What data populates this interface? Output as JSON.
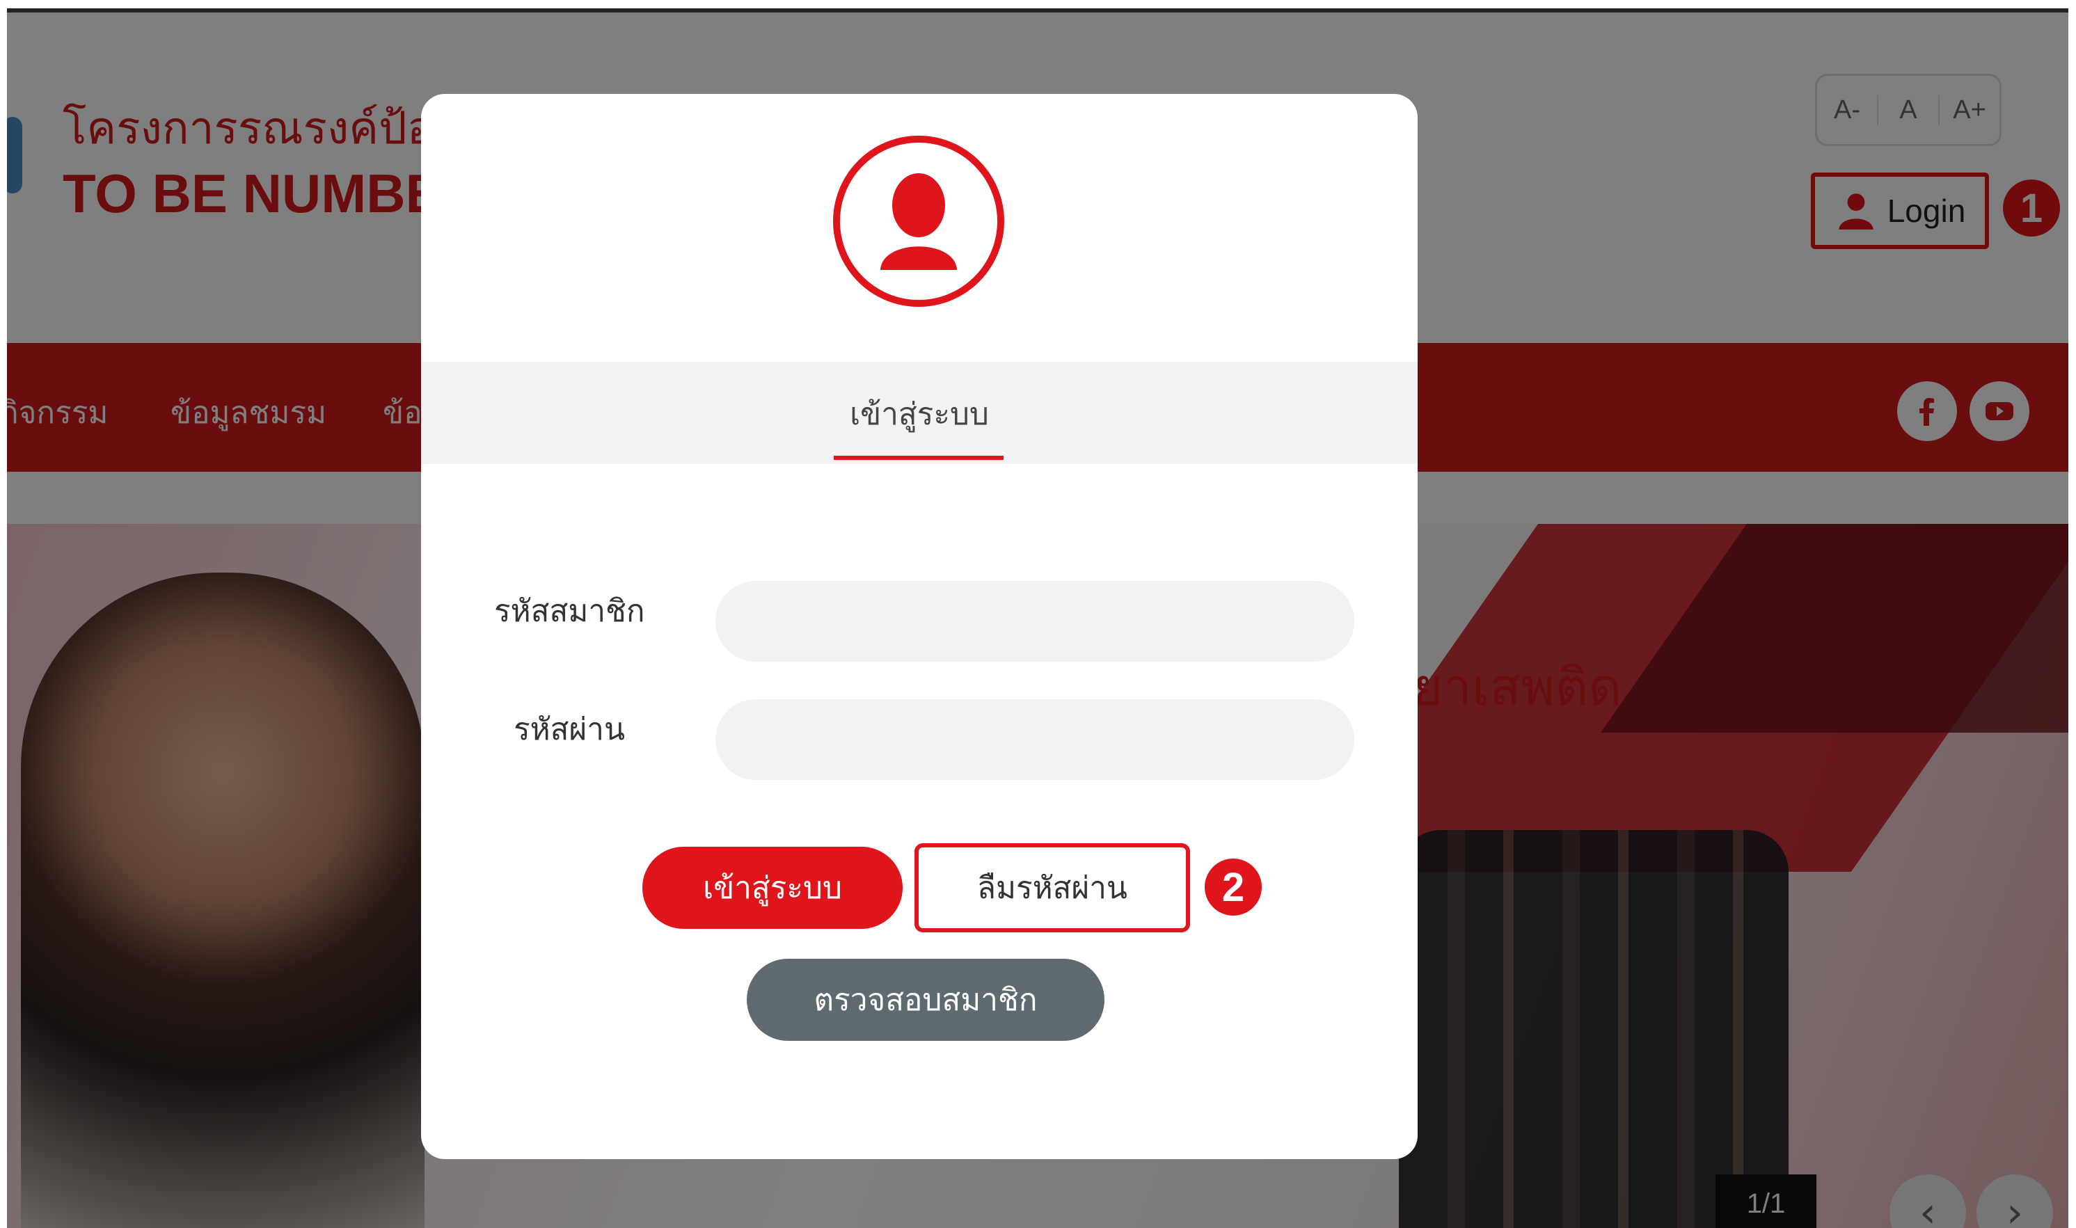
{
  "header": {
    "logo_line1": "โครงการรณรงค์ป้อ",
    "logo_line2": "TO BE NUMBER",
    "font_size_controls": [
      "A-",
      "A",
      "A+"
    ],
    "login_label": "Login",
    "step1_badge": "1"
  },
  "nav": {
    "items": [
      "กิจกรรม",
      "ข้อมูลชมรม",
      "ข้อ"
    ],
    "social": [
      "facebook-icon",
      "youtube-icon"
    ]
  },
  "hero": {
    "title": "ยาเสพติด",
    "pager": "1/1",
    "prev_arrow": "‹",
    "next_arrow": "›"
  },
  "modal": {
    "tab_label": "เข้าสู่ระบบ",
    "member_id_label": "รหัสสมาชิก",
    "member_id_value": "",
    "password_label": "รหัสผ่าน",
    "password_value": "",
    "login_button": "เข้าสู่ระบบ",
    "forgot_button": "ลืมรหัสผ่าน",
    "step2_badge": "2",
    "check_member_button": "ตรวจสอบสมาชิก"
  },
  "colors": {
    "brand_red": "#d31a1f",
    "highlight_red": "#e0141b",
    "secondary_button": "#5f6970"
  }
}
